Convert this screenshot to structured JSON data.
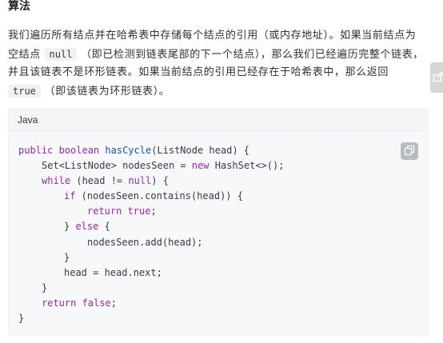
{
  "heading": "算法",
  "paragraph": {
    "part1": "我们遍历所有结点并在哈希表中存储每个结点的引用（或内存地址）。如果当前结点为空结点",
    "code1": "null",
    "part2": "（即已检测到链表尾部的下一个结点），那么我们已经遍历完整个链表，并且该链表不是环形链表。如果当前结点的引用已经存在于哈希表中，那么返回",
    "code2": "true",
    "part3": "（即该链表为环形链表）。"
  },
  "code_block": {
    "language": "Java",
    "lines": {
      "l1": {
        "kw1": "public boolean",
        "fn": "hasCycle",
        "rest": "(ListNode head) {"
      },
      "l2": {
        "pre": "Set<ListNode> nodesSeen = ",
        "kw": "new",
        "rest": " HashSet<>();"
      },
      "l3": {
        "kw": "while",
        "mid": " (head != ",
        "kw2": "null",
        "rest": ") {"
      },
      "l4": {
        "kw": "if",
        "rest": " (nodesSeen.contains(head)) {"
      },
      "l5": {
        "kw": "return true",
        "rest": ";"
      },
      "l6": {
        "pre": "} ",
        "kw": "else",
        "rest": " {"
      },
      "l7": {
        "text": "nodesSeen.add(head);"
      },
      "l8": {
        "text": "}"
      },
      "l9": {
        "text": "head = head.next;"
      },
      "l10": {
        "text": "}"
      },
      "l11": {
        "kw": "return false",
        "rest": ";"
      },
      "l12": {
        "text": "}"
      }
    }
  },
  "icons": {
    "share": "share-icon",
    "copy": "copy-icon"
  },
  "colors": {
    "keyword": "#9c27b0",
    "function": "#1a4fc0",
    "code_background": "#f7f8fa"
  }
}
